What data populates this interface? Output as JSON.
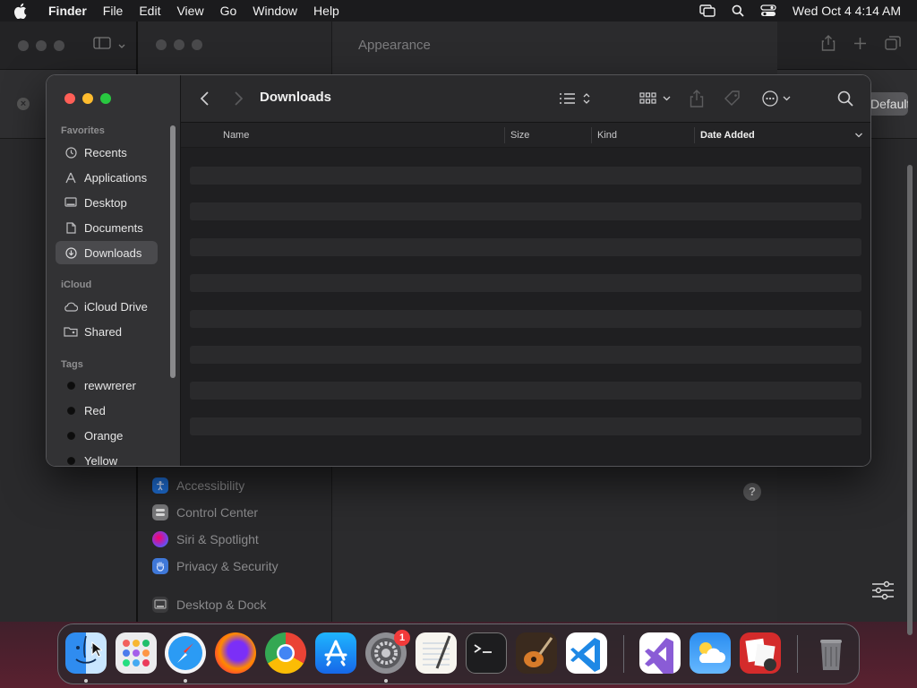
{
  "menubar": {
    "app_name": "Finder",
    "items": [
      "File",
      "Edit",
      "View",
      "Go",
      "Window",
      "Help"
    ],
    "clock": "Wed Oct 4  4:14 AM"
  },
  "settings_window": {
    "pane_title": "Appearance",
    "default_button": "Default",
    "sidebar_items": [
      {
        "label": "Accessibility",
        "icon": "accessibility-icon",
        "color": "#1f6fd6"
      },
      {
        "label": "Control Center",
        "icon": "control-center-icon",
        "color": "#7a7a7c"
      },
      {
        "label": "Siri & Spotlight",
        "icon": "siri-icon",
        "color": "#c94bd8"
      },
      {
        "label": "Privacy & Security",
        "icon": "privacy-hand-icon",
        "color": "#3f78d9"
      },
      {
        "label": "Desktop & Dock",
        "icon": "desktop-dock-icon",
        "color": "#3b3b3d"
      }
    ],
    "help_label": "?"
  },
  "finder": {
    "title": "Downloads",
    "sidebar": {
      "favorites_title": "Favorites",
      "favorites": [
        {
          "label": "Recents",
          "icon": "clock-icon",
          "selected": false
        },
        {
          "label": "Applications",
          "icon": "applications-icon",
          "selected": false
        },
        {
          "label": "Desktop",
          "icon": "desktop-icon",
          "selected": false
        },
        {
          "label": "Documents",
          "icon": "document-icon",
          "selected": false
        },
        {
          "label": "Downloads",
          "icon": "download-icon",
          "selected": true
        }
      ],
      "icloud_title": "iCloud",
      "icloud": [
        {
          "label": "iCloud Drive",
          "icon": "cloud-icon"
        },
        {
          "label": "Shared",
          "icon": "shared-folder-icon"
        }
      ],
      "tags_title": "Tags",
      "tags": [
        {
          "label": "rewwrerer"
        },
        {
          "label": "Red"
        },
        {
          "label": "Orange"
        },
        {
          "label": "Yellow"
        }
      ]
    },
    "columns": [
      {
        "label": "Name"
      },
      {
        "label": "Size"
      },
      {
        "label": "Kind"
      },
      {
        "label": "Date Added",
        "sorted": true
      }
    ],
    "row_count": 8
  },
  "dock": {
    "apps": [
      {
        "name": "Finder",
        "icon": "finder-icon",
        "running": true
      },
      {
        "name": "Launchpad",
        "icon": "launchpad-icon",
        "running": false
      },
      {
        "name": "Safari",
        "icon": "safari-icon",
        "running": true
      },
      {
        "name": "Firefox",
        "icon": "firefox-icon",
        "running": false
      },
      {
        "name": "Chrome",
        "icon": "chrome-icon",
        "running": false
      },
      {
        "name": "App Store",
        "icon": "app-store-icon",
        "running": false
      },
      {
        "name": "System Settings",
        "icon": "system-settings-icon",
        "running": true,
        "badge": "1"
      },
      {
        "name": "TextEdit",
        "icon": "textedit-icon",
        "running": false
      },
      {
        "name": "Terminal",
        "icon": "terminal-icon",
        "running": false
      },
      {
        "name": "GarageBand",
        "icon": "garageband-icon",
        "running": false
      },
      {
        "name": "VS Code",
        "icon": "vscode-icon",
        "running": false
      },
      {
        "name": "Visual Studio",
        "icon": "visual-studio-icon",
        "running": false
      },
      {
        "name": "Weather",
        "icon": "weather-icon",
        "running": false
      },
      {
        "name": "Photo Booth",
        "icon": "photo-booth-icon",
        "running": false
      },
      {
        "name": "Trash",
        "icon": "trash-icon",
        "running": false
      }
    ]
  }
}
